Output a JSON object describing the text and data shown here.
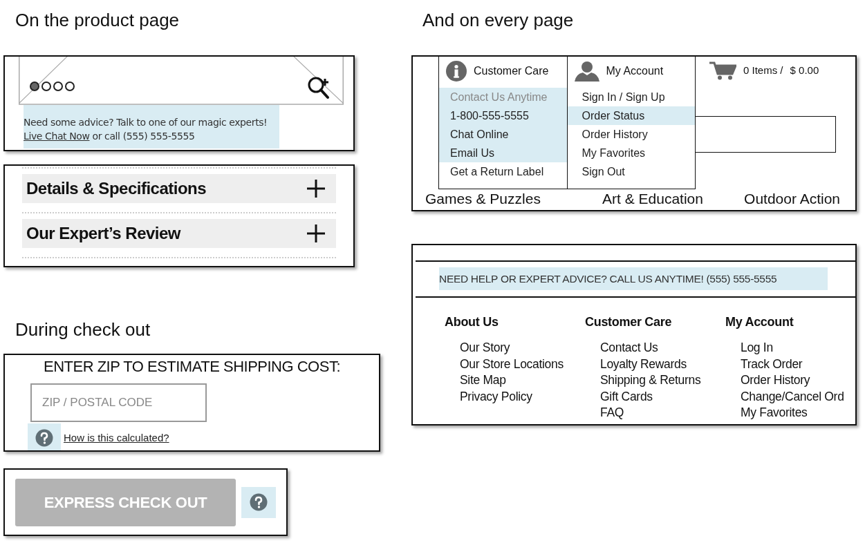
{
  "product_page": {
    "heading": "On the product page",
    "carousel": {
      "dots": [
        {
          "selected": true
        },
        {
          "selected": false
        },
        {
          "selected": false
        },
        {
          "selected": false
        }
      ]
    },
    "advice": {
      "highlighted": true,
      "text": "Need some advice? Talk to one of our magic experts!",
      "link": "Live Chat Now",
      "suffix": "or call (555) 555-5555"
    },
    "accordion": [
      {
        "title": "Details & Specifications",
        "expanded": false
      },
      {
        "title": "Our Expert’s Review",
        "expanded": false
      }
    ]
  },
  "every_page": {
    "heading": "And on every page",
    "header": {
      "menus": [
        {
          "title": "Customer Care",
          "items": [
            {
              "label": "Contact Us Anytime",
              "kind": "caption",
              "highlighted": true
            },
            {
              "label": "1-800-555-5555",
              "kind": "link",
              "highlighted": true
            },
            {
              "label": "Chat Online",
              "kind": "link",
              "highlighted": true
            },
            {
              "label": "Email Us",
              "kind": "link",
              "highlighted": true
            },
            {
              "label": "Get a Return Label",
              "kind": "link",
              "highlighted": false
            }
          ]
        },
        {
          "title": "My Account",
          "items": [
            {
              "label": "Sign In / Sign Up",
              "kind": "link",
              "highlighted": false
            },
            {
              "label": "Order Status",
              "kind": "link",
              "highlighted": true
            },
            {
              "label": "Order History",
              "kind": "link",
              "highlighted": false
            },
            {
              "label": "My Favorites",
              "kind": "link",
              "highlighted": false
            },
            {
              "label": "Sign Out",
              "kind": "link",
              "highlighted": false
            }
          ]
        }
      ],
      "cart": {
        "items": "0 Items /",
        "total": "$ 0.00"
      },
      "categories": [
        "Games & Puzzles",
        "Art & Education",
        "Outdoor Action"
      ]
    },
    "footer": {
      "banner": {
        "text": "NEED HELP OR EXPERT ADVICE? CALL US ANYTIME! (555) 555-5555",
        "highlighted": true
      },
      "columns": [
        {
          "title": "About Us",
          "links": [
            "Our Story",
            "Our Store Locations",
            "Site Map",
            "Privacy Policy"
          ]
        },
        {
          "title": "Customer Care",
          "links": [
            "Contact Us",
            "Loyalty Rewards",
            "Shipping & Returns",
            "Gift Cards",
            "FAQ"
          ]
        },
        {
          "title": "My Account",
          "links": [
            "Log In",
            "Track Order",
            "Order History",
            "Change/Cancel Ord",
            "My Favorites"
          ]
        }
      ]
    }
  },
  "checkout": {
    "heading": "During check out",
    "shipping": {
      "title": "ENTER ZIP TO ESTIMATE SHIPPING COST:",
      "placeholder": "ZIP / POSTAL CODE",
      "help_highlighted": true,
      "help_link": "How is this calculated?"
    },
    "express": {
      "label": "EXPRESS CHECK OUT",
      "disabled": true,
      "help_highlighted": true
    }
  }
}
